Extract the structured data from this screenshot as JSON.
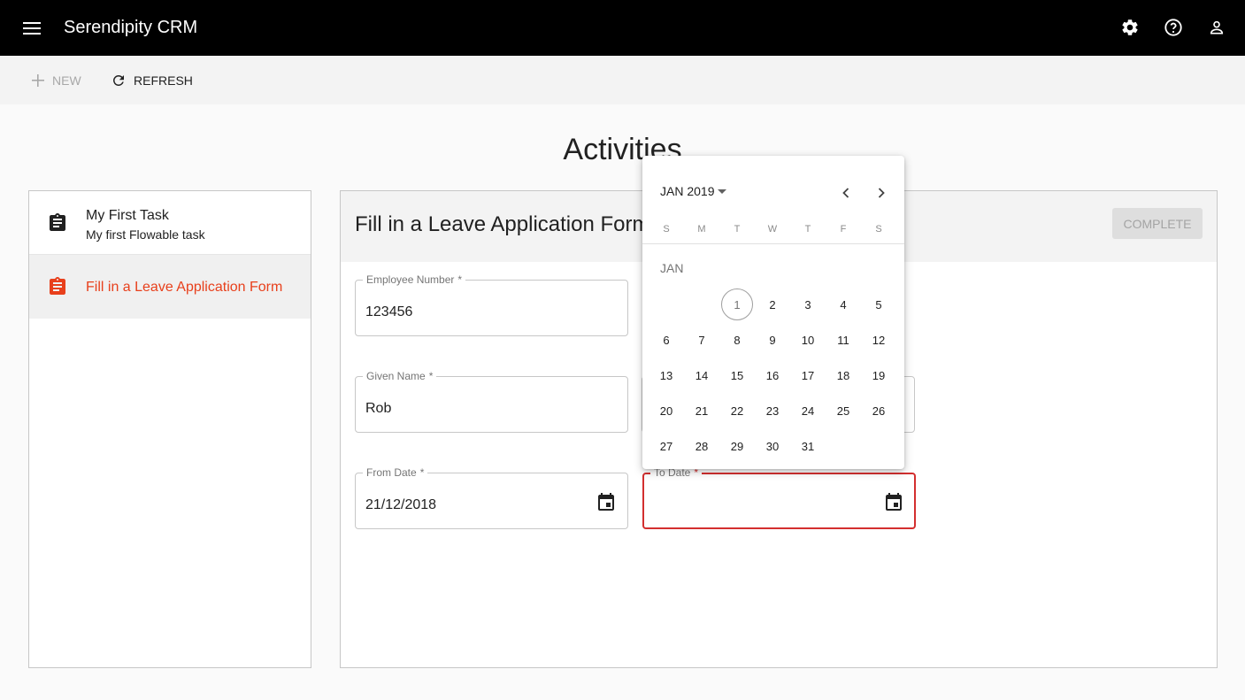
{
  "app": {
    "title": "Serendipity CRM"
  },
  "icons": {
    "menu": "menu-icon",
    "settings": "gear-icon",
    "help": "help-circle-icon",
    "account": "account-icon",
    "calendar": "calendar-icon",
    "task": "clipboard-icon"
  },
  "colors": {
    "accent": "#e8401c",
    "error": "#d32f2f",
    "topbar": "#000000"
  },
  "toolbar": {
    "new_label": "NEW",
    "refresh_label": "REFRESH"
  },
  "page": {
    "title": "Activities"
  },
  "tasks": [
    {
      "title": "My First Task",
      "subtitle": "My first Flowable task",
      "selected": false
    },
    {
      "title": "Fill in a Leave Application Form",
      "subtitle": "",
      "selected": true
    }
  ],
  "form": {
    "title": "Fill in a Leave Application Form",
    "complete_label": "COMPLETE",
    "fields": {
      "employee_number": {
        "label": "Employee Number",
        "required": "*",
        "value": "123456"
      },
      "given_name": {
        "label": "Given Name",
        "required": "*",
        "value": "Rob"
      },
      "from_date": {
        "label": "From Date",
        "required": "*",
        "value": "21/12/2018"
      },
      "to_date": {
        "label": "To Date",
        "required": "*",
        "value": ""
      }
    }
  },
  "datepicker": {
    "month_year": "JAN 2019",
    "month_label": "JAN",
    "weekdays": [
      "S",
      "M",
      "T",
      "W",
      "T",
      "F",
      "S"
    ],
    "first_weekday_index": 2,
    "today": 1,
    "days": [
      "1",
      "2",
      "3",
      "4",
      "5",
      "6",
      "7",
      "8",
      "9",
      "10",
      "11",
      "12",
      "13",
      "14",
      "15",
      "16",
      "17",
      "18",
      "19",
      "20",
      "21",
      "22",
      "23",
      "24",
      "25",
      "26",
      "27",
      "28",
      "29",
      "30",
      "31"
    ]
  }
}
